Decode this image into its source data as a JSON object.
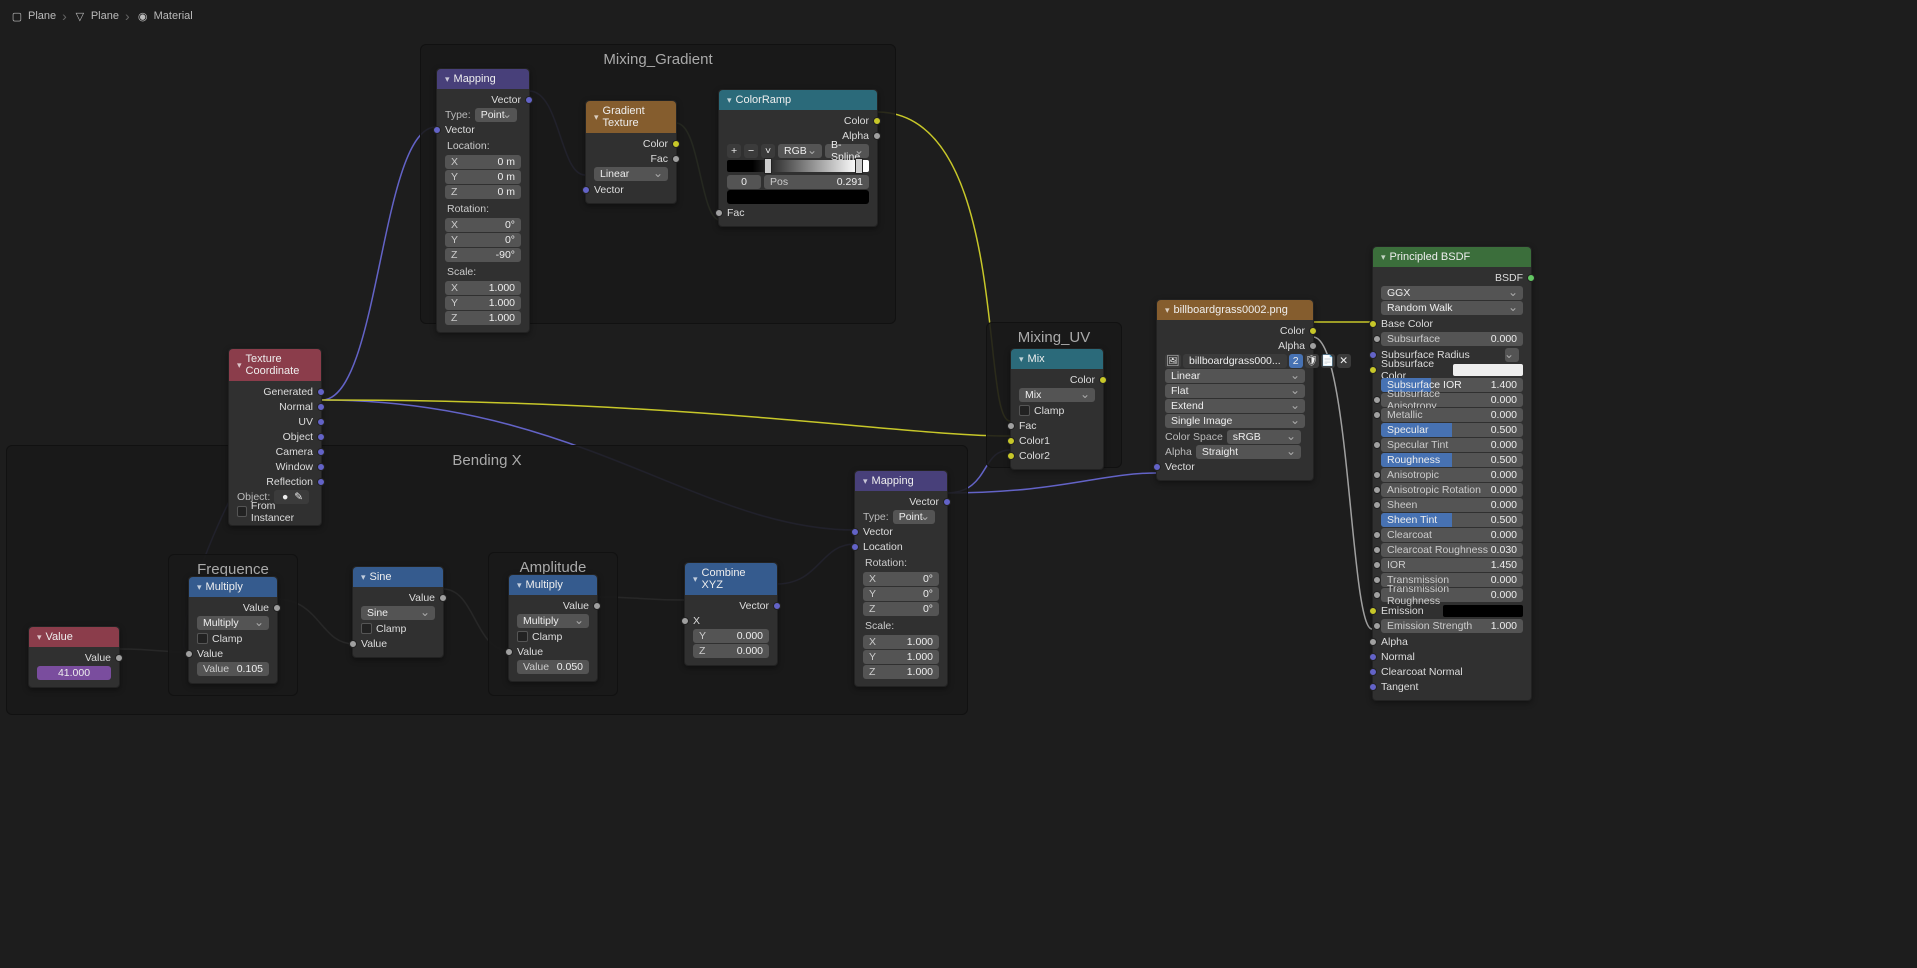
{
  "breadcrumb": [
    "Plane",
    "Plane",
    "Material"
  ],
  "frames": {
    "mixing_gradient": {
      "title": "Mixing_Gradient"
    },
    "bending_x": {
      "title": "Bending X"
    },
    "frequence": {
      "title": "Frequence"
    },
    "amplitude": {
      "title": "Amplitude"
    },
    "mixing_uv": {
      "title": "Mixing_UV"
    }
  },
  "nodes": {
    "value": {
      "title": "Value",
      "outputs": [
        "Value"
      ],
      "value": "41.000"
    },
    "texcoord": {
      "title": "Texture Coordinate",
      "outputs": [
        "Generated",
        "Normal",
        "UV",
        "Object",
        "Camera",
        "Window",
        "Reflection"
      ],
      "object_label": "Object:",
      "from_instancer": "From Instancer"
    },
    "mapping1": {
      "title": "Mapping",
      "outputs": [
        "Vector"
      ],
      "type_label": "Type:",
      "type_value": "Point",
      "inputs": [
        "Vector"
      ],
      "location_label": "Location:",
      "loc": {
        "X": "0 m",
        "Y": "0 m",
        "Z": "0 m"
      },
      "rotation_label": "Rotation:",
      "rot": {
        "X": "0°",
        "Y": "0°",
        "Z": "-90°"
      },
      "scale_label": "Scale:",
      "scl": {
        "X": "1.000",
        "Y": "1.000",
        "Z": "1.000"
      }
    },
    "gradient": {
      "title": "Gradient Texture",
      "outputs": [
        "Color",
        "Fac"
      ],
      "type": "Linear",
      "inputs": [
        "Vector"
      ]
    },
    "colorramp": {
      "title": "ColorRamp",
      "outputs": [
        "Color",
        "Alpha"
      ],
      "ops": {
        "add": "+",
        "remove": "−",
        "menu": "˅"
      },
      "color_mode": "RGB",
      "interp": "B-Spline",
      "stop_index": "0",
      "pos_label": "Pos",
      "pos_value": "0.291",
      "inputs": [
        "Fac"
      ]
    },
    "multiply1": {
      "title": "Multiply",
      "outputs": [
        "Value"
      ],
      "op": "Multiply",
      "clamp": "Clamp",
      "inputs": [
        "Value"
      ],
      "value_label": "Value",
      "value": "0.105"
    },
    "sine": {
      "title": "Sine",
      "outputs": [
        "Value"
      ],
      "op": "Sine",
      "clamp": "Clamp",
      "inputs": [
        "Value"
      ]
    },
    "multiply2": {
      "title": "Multiply",
      "outputs": [
        "Value"
      ],
      "op": "Multiply",
      "clamp": "Clamp",
      "inputs": [
        "Value"
      ],
      "value_label": "Value",
      "value": "0.050"
    },
    "combine": {
      "title": "Combine XYZ",
      "outputs": [
        "Vector"
      ],
      "x_label": "X",
      "y_label": "Y",
      "y_value": "0.000",
      "z_label": "Z",
      "z_value": "0.000"
    },
    "mapping2": {
      "title": "Mapping",
      "outputs": [
        "Vector"
      ],
      "type_label": "Type:",
      "type_value": "Point",
      "inputs": [
        "Vector"
      ],
      "location_label": "Location",
      "rotation_label": "Rotation:",
      "rot": {
        "X": "0°",
        "Y": "0°",
        "Z": "0°"
      },
      "scale_label": "Scale:",
      "scl": {
        "X": "1.000",
        "Y": "1.000",
        "Z": "1.000"
      }
    },
    "mix": {
      "title": "Mix",
      "outputs": [
        "Color"
      ],
      "blend": "Mix",
      "clamp": "Clamp",
      "inputs": [
        "Fac",
        "Color1",
        "Color2"
      ]
    },
    "imgtex": {
      "title": "billboardgrass0002.png",
      "outputs": [
        "Color",
        "Alpha"
      ],
      "image": "billboardgrass000...",
      "interp": "Linear",
      "projection": "Flat",
      "extension": "Extend",
      "source": "Single Image",
      "cs_label": "Color Space",
      "cs_value": "sRGB",
      "alpha_label": "Alpha",
      "alpha_value": "Straight",
      "inputs": [
        "Vector"
      ]
    },
    "bsdf": {
      "title": "Principled BSDF",
      "outputs": [
        "BSDF"
      ],
      "dist": "GGX",
      "sss": "Random Walk",
      "params": [
        {
          "k": "Base Color",
          "type": "socket-color"
        },
        {
          "k": "Subsurface",
          "v": "0.000"
        },
        {
          "k": "Subsurface Radius",
          "type": "select"
        },
        {
          "k": "Subsurface Color",
          "type": "swatch",
          "color": "#eee"
        },
        {
          "k": "Subsurface IOR",
          "v": "1.400",
          "fill": 35,
          "blue": true
        },
        {
          "k": "Subsurface Anisotropy",
          "v": "0.000"
        },
        {
          "k": "Metallic",
          "v": "0.000"
        },
        {
          "k": "Specular",
          "v": "0.500",
          "fill": 50,
          "blue": true
        },
        {
          "k": "Specular Tint",
          "v": "0.000"
        },
        {
          "k": "Roughness",
          "v": "0.500",
          "fill": 50,
          "blue": true
        },
        {
          "k": "Anisotropic",
          "v": "0.000"
        },
        {
          "k": "Anisotropic Rotation",
          "v": "0.000"
        },
        {
          "k": "Sheen",
          "v": "0.000"
        },
        {
          "k": "Sheen Tint",
          "v": "0.500",
          "fill": 50,
          "blue": true
        },
        {
          "k": "Clearcoat",
          "v": "0.000"
        },
        {
          "k": "Clearcoat Roughness",
          "v": "0.030"
        },
        {
          "k": "IOR",
          "v": "1.450"
        },
        {
          "k": "Transmission",
          "v": "0.000"
        },
        {
          "k": "Transmission Roughness",
          "v": "0.000"
        },
        {
          "k": "Emission",
          "type": "swatch",
          "color": "#000"
        },
        {
          "k": "Emission Strength",
          "v": "1.000"
        },
        {
          "k": "Alpha",
          "type": "socket"
        },
        {
          "k": "Normal",
          "type": "socket"
        },
        {
          "k": "Clearcoat Normal",
          "type": "socket"
        },
        {
          "k": "Tangent",
          "type": "socket"
        }
      ]
    }
  }
}
